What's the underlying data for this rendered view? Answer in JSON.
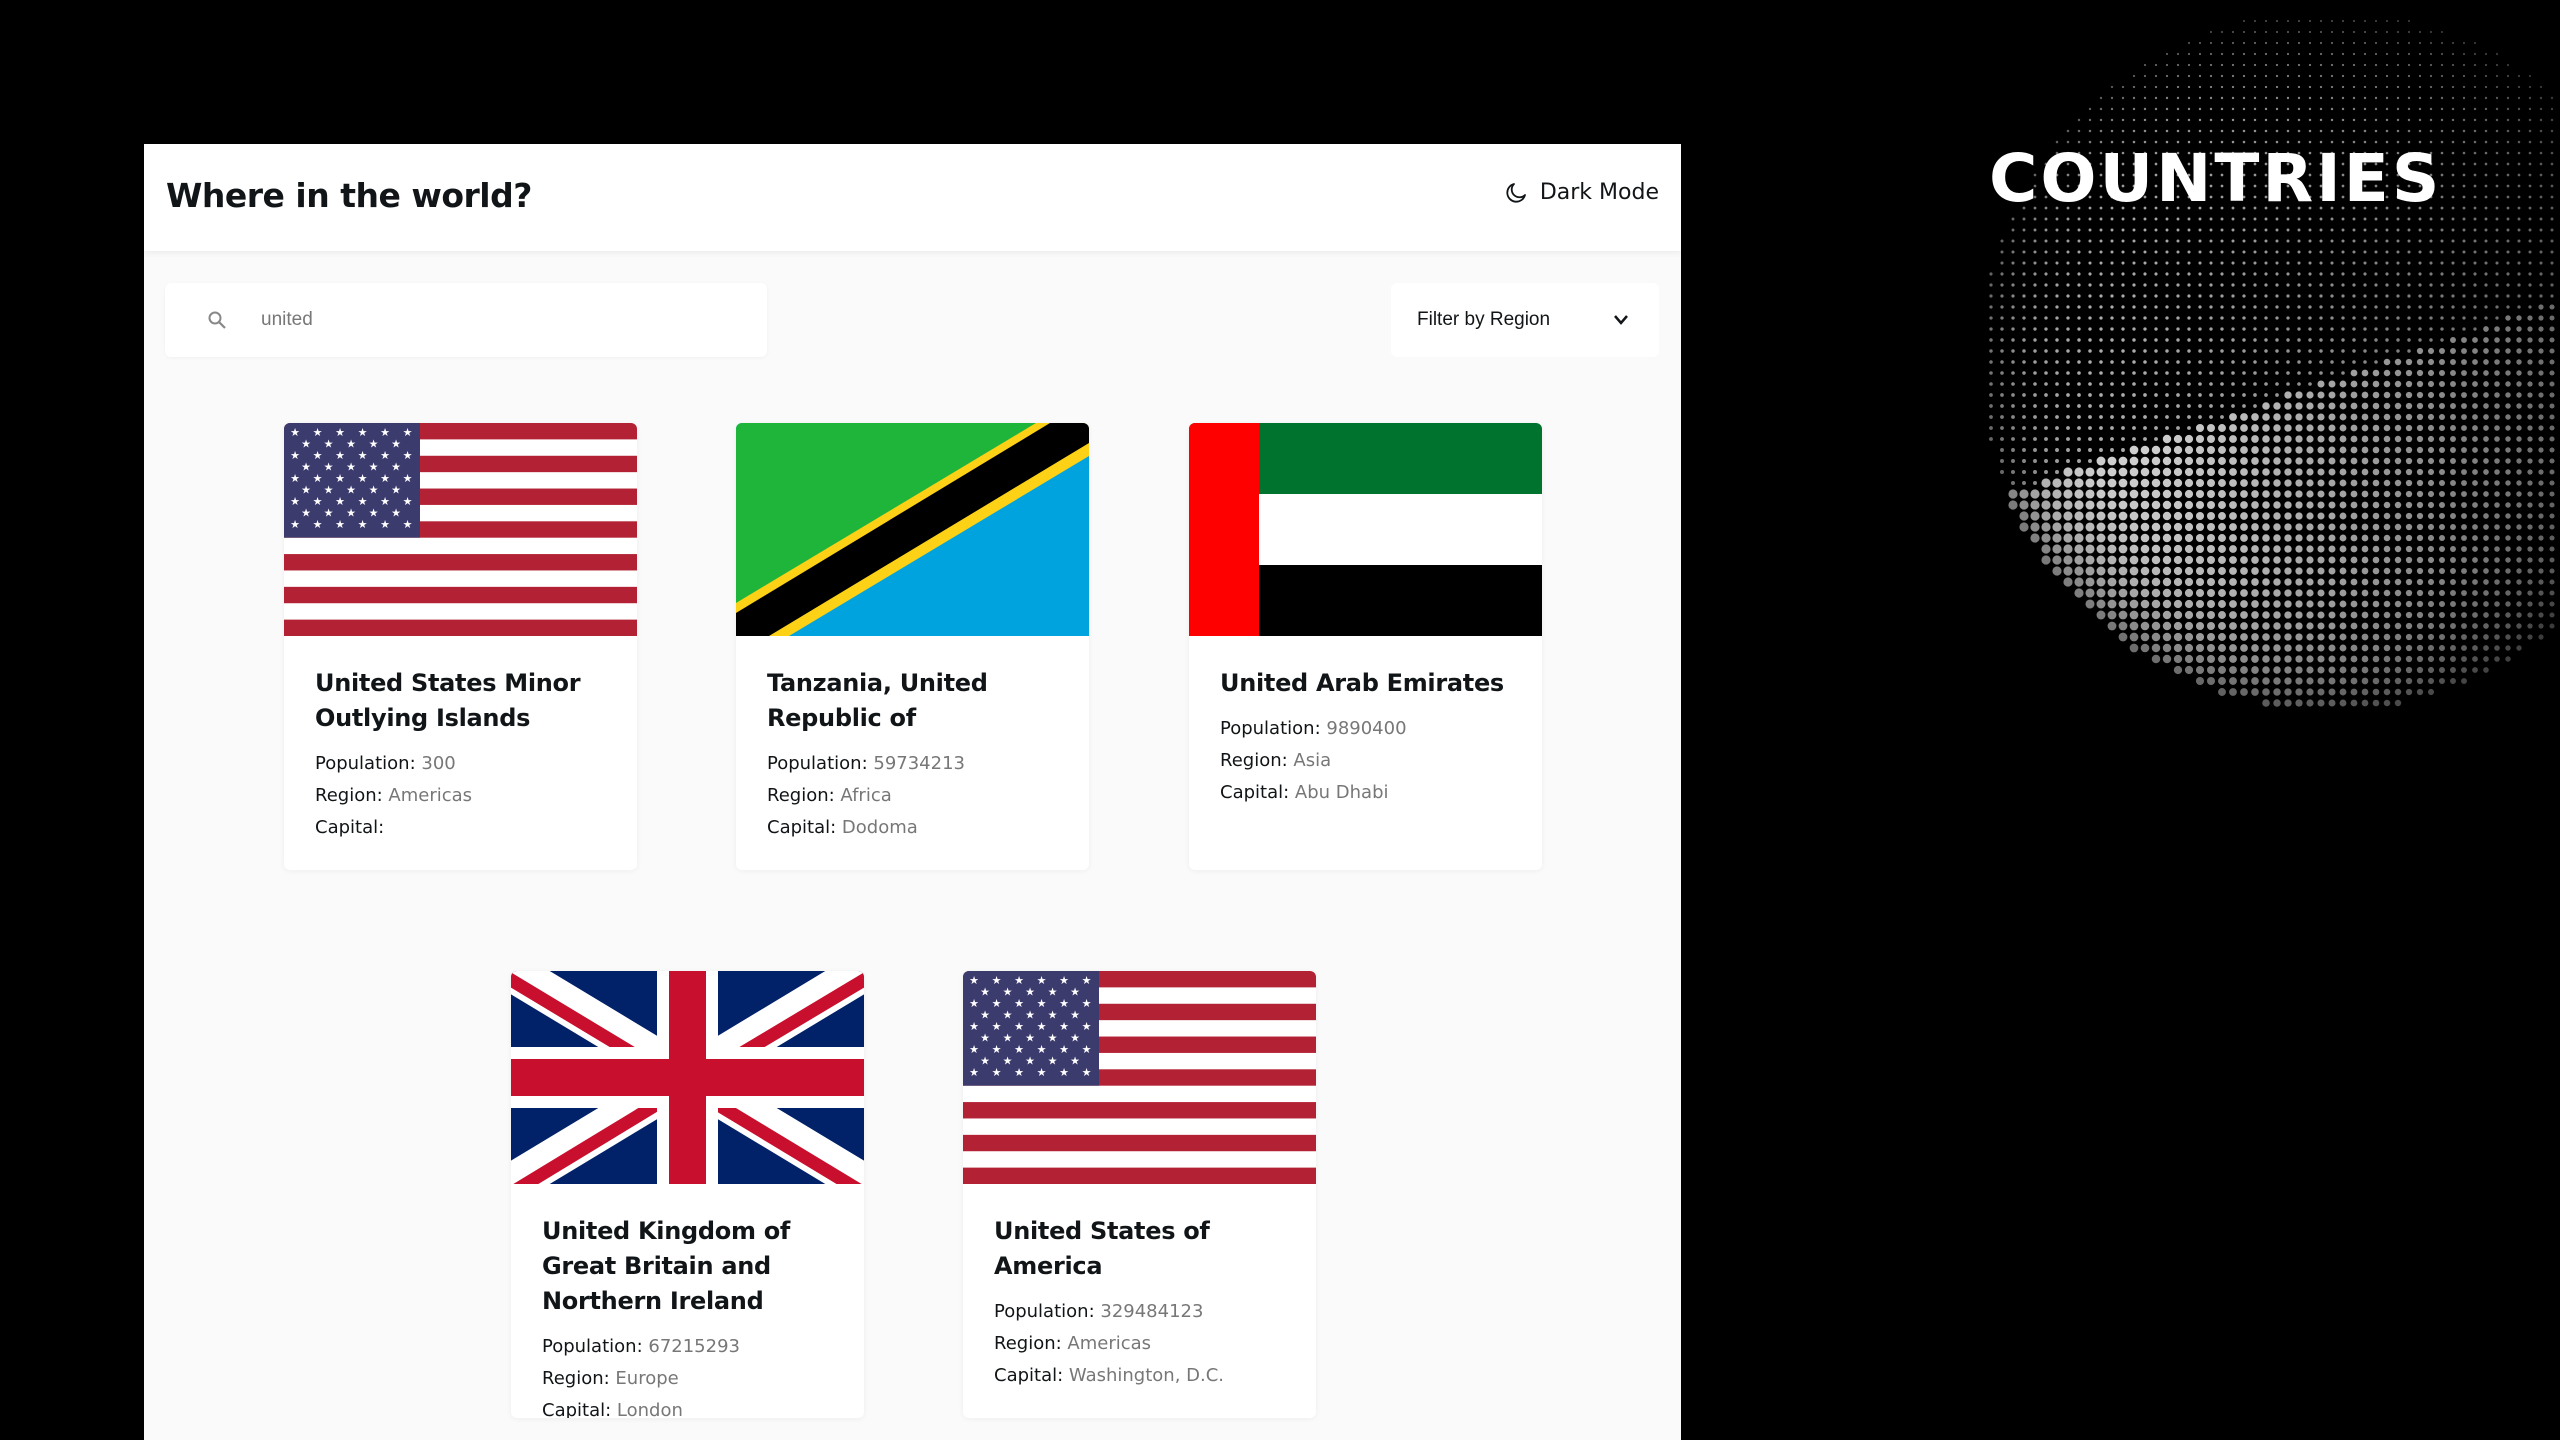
{
  "header": {
    "title": "Where in the world?",
    "dark_mode_label": "Dark Mode",
    "dark_mode_icon": "moon-icon"
  },
  "search": {
    "value": "united",
    "icon": "search-icon"
  },
  "filter": {
    "label": "Filter by Region",
    "icon": "chevron-down-icon"
  },
  "labels": {
    "population": "Population:",
    "region": "Region:",
    "capital": "Capital:"
  },
  "countries": [
    {
      "name": "United States Minor Outlying Islands",
      "population": "300",
      "region": "Americas",
      "capital": "",
      "flag": "us"
    },
    {
      "name": "Tanzania, United Republic of",
      "population": "59734213",
      "region": "Africa",
      "capital": "Dodoma",
      "flag": "tz"
    },
    {
      "name": "United Arab Emirates",
      "population": "9890400",
      "region": "Asia",
      "capital": "Abu Dhabi",
      "flag": "ae"
    },
    {
      "name": "United Kingdom of Great Britain and Northern Ireland",
      "population": "67215293",
      "region": "Europe",
      "capital": "London",
      "flag": "gb"
    },
    {
      "name": "United States of America",
      "population": "329484123",
      "region": "Americas",
      "capital": "Washington, D.C.",
      "flag": "us"
    }
  ],
  "branding": {
    "title": "COUNTRIES"
  },
  "colors": {
    "panel_bg": "#fafafa",
    "text": "#111517",
    "muted": "#777777"
  }
}
